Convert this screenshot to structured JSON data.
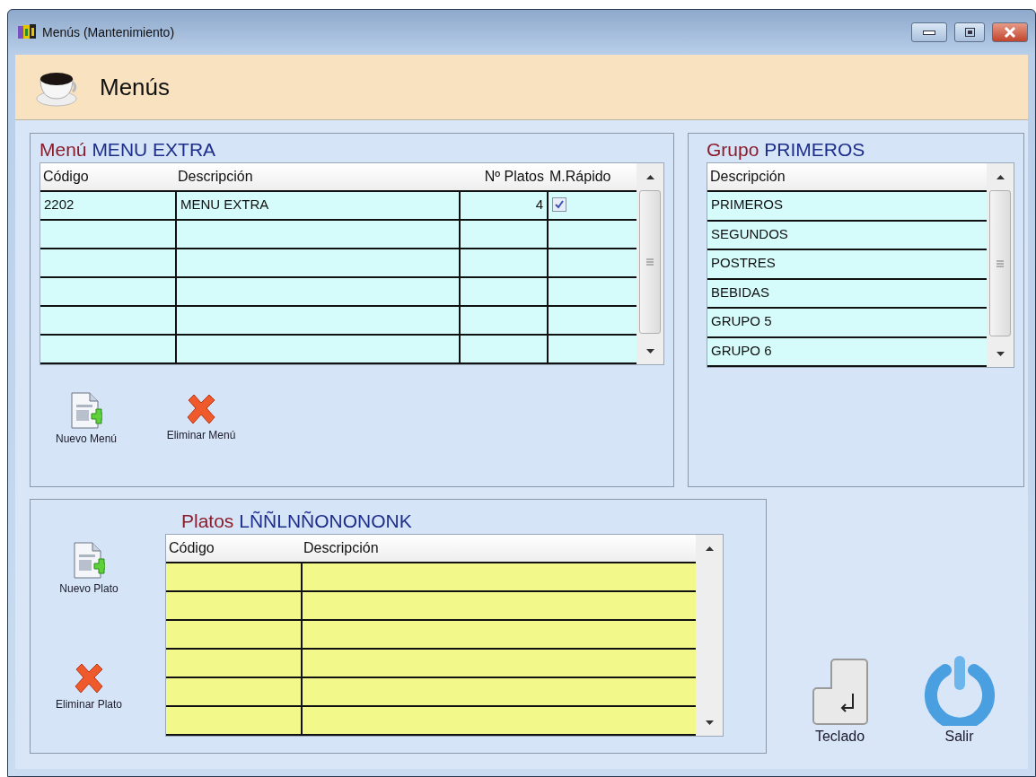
{
  "window": {
    "title": "Menús (Mantenimiento)"
  },
  "header": {
    "title": "Menús"
  },
  "menu_panel": {
    "label": "Menú",
    "value": "MENU EXTRA",
    "columns": [
      "Código",
      "Descripción",
      "Nº Platos",
      "M.Rápido"
    ],
    "rows": [
      {
        "codigo": "2202",
        "descripcion": "MENU EXTRA",
        "platos": "4",
        "rapido": true
      }
    ],
    "buttons": [
      {
        "label": "Nuevo Menú",
        "kind": "new"
      },
      {
        "label": "Eliminar Menú",
        "kind": "delete"
      }
    ]
  },
  "group_panel": {
    "label": "Grupo",
    "value": "PRIMEROS",
    "columns": [
      "Descripción"
    ],
    "rows": [
      "PRIMEROS",
      "SEGUNDOS",
      "POSTRES",
      "BEBIDAS",
      "GRUPO 5",
      "GRUPO 6"
    ]
  },
  "dishes_panel": {
    "label": "Platos",
    "value": "LÑÑLNÑONONONK",
    "columns": [
      "Código",
      "Descripción"
    ],
    "buttons": [
      {
        "label": "Nuevo Plato",
        "kind": "new"
      },
      {
        "label": "Eliminar Plato",
        "kind": "delete"
      }
    ]
  },
  "actions": [
    {
      "label": "Teclado",
      "kind": "keyboard"
    },
    {
      "label": "Salir",
      "kind": "power"
    }
  ]
}
